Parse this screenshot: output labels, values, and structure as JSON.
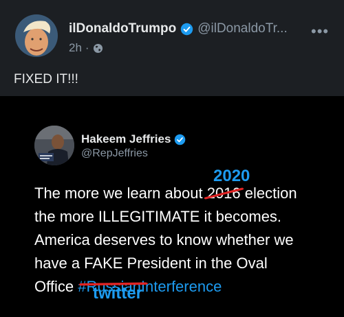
{
  "post": {
    "display_name": "ilDonaldoTrumpo",
    "handle": "@ilDonaldoTr...",
    "time": "2h",
    "separator": "·",
    "text": "FIXED IT!!!",
    "more": "•••"
  },
  "embedded_tweet": {
    "display_name": "Hakeem Jeffries",
    "handle": "@RepJeffries",
    "lines": {
      "l1_pre": "The more we learn about ",
      "l1_struck": "2016",
      "l1_post": " election",
      "l2": "the more ILLEGITIMATE it becomes.",
      "l3": "America deserves to know whether we",
      "l4": "have a FAKE President in the Oval",
      "l5_pre": "Office ",
      "l5_hashtag_start": "#",
      "l5_struck": "Russian",
      "l5_hashtag_end": "Interference"
    }
  },
  "annotations": {
    "year_fix": "2020",
    "word_fix": "twitter"
  },
  "colors": {
    "link_blue": "#1d9bf0",
    "strike_red": "#e02424",
    "verified_blue": "#1d9bf0"
  }
}
